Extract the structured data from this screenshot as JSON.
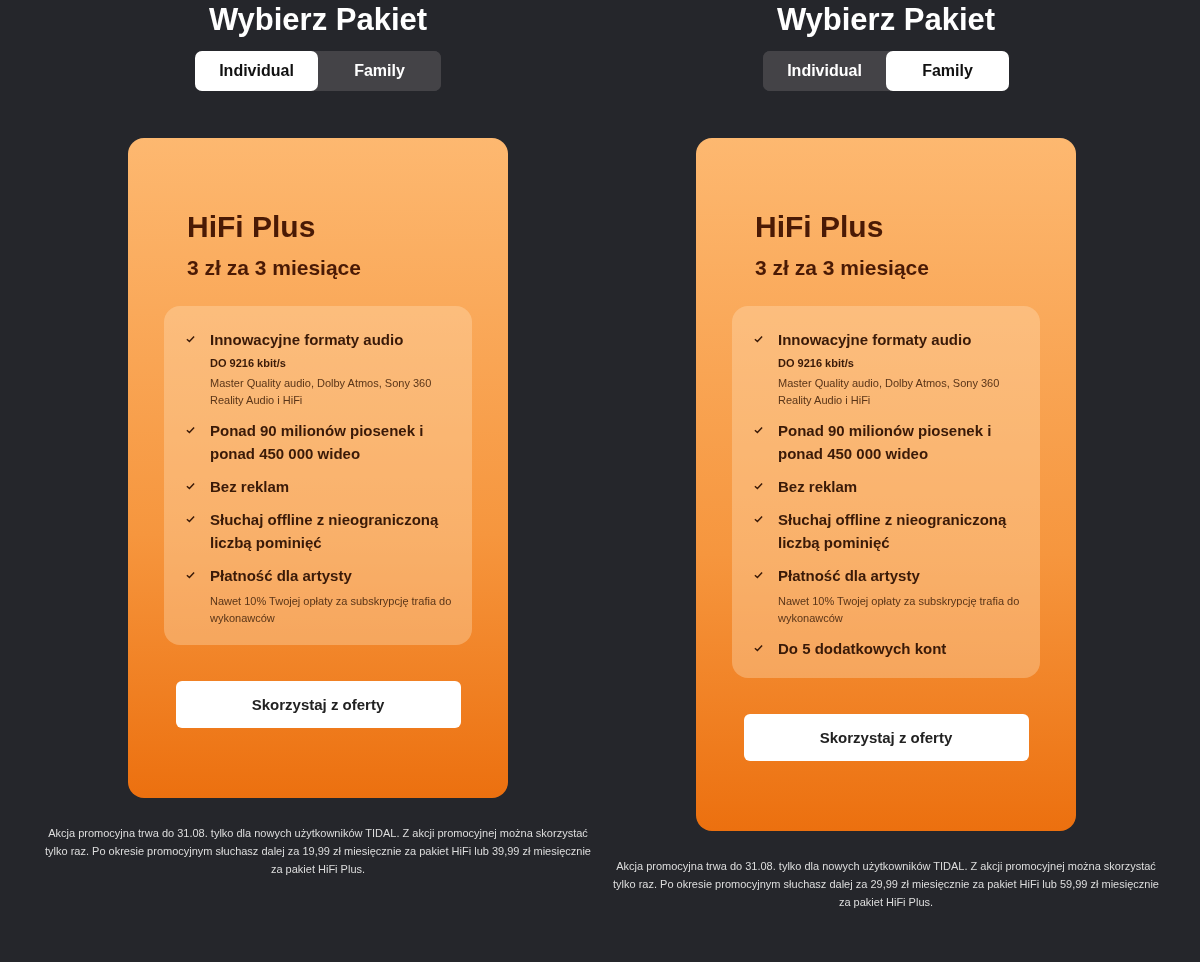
{
  "panels": [
    {
      "title": "Wybierz Pakiet",
      "tabs": [
        {
          "label": "Individual",
          "selected": true
        },
        {
          "label": "Family",
          "selected": false
        }
      ],
      "card": {
        "name": "HiFi Plus",
        "price": "3 zł za 3 miesiące",
        "features": [
          {
            "title": "Innowacyjne formaty audio",
            "subtitle": "DO 9216 kbit/s",
            "note": "Master Quality audio, Dolby Atmos, Sony 360 Reality Audio i HiFi"
          },
          {
            "title": "Ponad 90 milionów piosenek i ponad 450 000 wideo"
          },
          {
            "title": "Bez reklam"
          },
          {
            "title": "Słuchaj offline z nieograniczoną liczbą pominięć"
          },
          {
            "title": "Płatność dla artysty",
            "note": "Nawet 10% Twojej opłaty za subskrypcję trafia do wykonawców"
          }
        ],
        "button": "Skorzystaj z oferty"
      },
      "footnote": "Akcja promocyjna trwa do 31.08. tylko dla nowych użytkowników TIDAL. Z akcji promocyjnej można skorzystać tylko raz. Po okresie promocyjnym słuchasz dalej za 19,99 zł miesięcznie za pakiet HiFi lub 39,99 zł miesięcznie za pakiet HiFi Plus."
    },
    {
      "title": "Wybierz Pakiet",
      "tabs": [
        {
          "label": "Individual",
          "selected": false
        },
        {
          "label": "Family",
          "selected": true
        }
      ],
      "card": {
        "name": "HiFi Plus",
        "price": "3 zł za 3 miesiące",
        "features": [
          {
            "title": "Innowacyjne formaty audio",
            "subtitle": "DO 9216 kbit/s",
            "note": "Master Quality audio, Dolby Atmos, Sony 360 Reality Audio i HiFi"
          },
          {
            "title": "Ponad 90 milionów piosenek i ponad 450 000 wideo"
          },
          {
            "title": "Bez reklam"
          },
          {
            "title": "Słuchaj offline z nieograniczoną liczbą pominięć"
          },
          {
            "title": "Płatność dla artysty",
            "note": "Nawet 10% Twojej opłaty za subskrypcję trafia do wykonawców"
          },
          {
            "title": "Do 5 dodatkowych kont"
          }
        ],
        "button": "Skorzystaj z oferty"
      },
      "footnote": "Akcja promocyjna trwa do 31.08. tylko dla nowych użytkowników TIDAL. Z akcji promocyjnej można skorzystać tylko raz. Po okresie promocyjnym słuchasz dalej za 29,99 zł miesięcznie za pakiet HiFi lub 59,99 zł miesięcznie za pakiet HiFi Plus."
    }
  ]
}
